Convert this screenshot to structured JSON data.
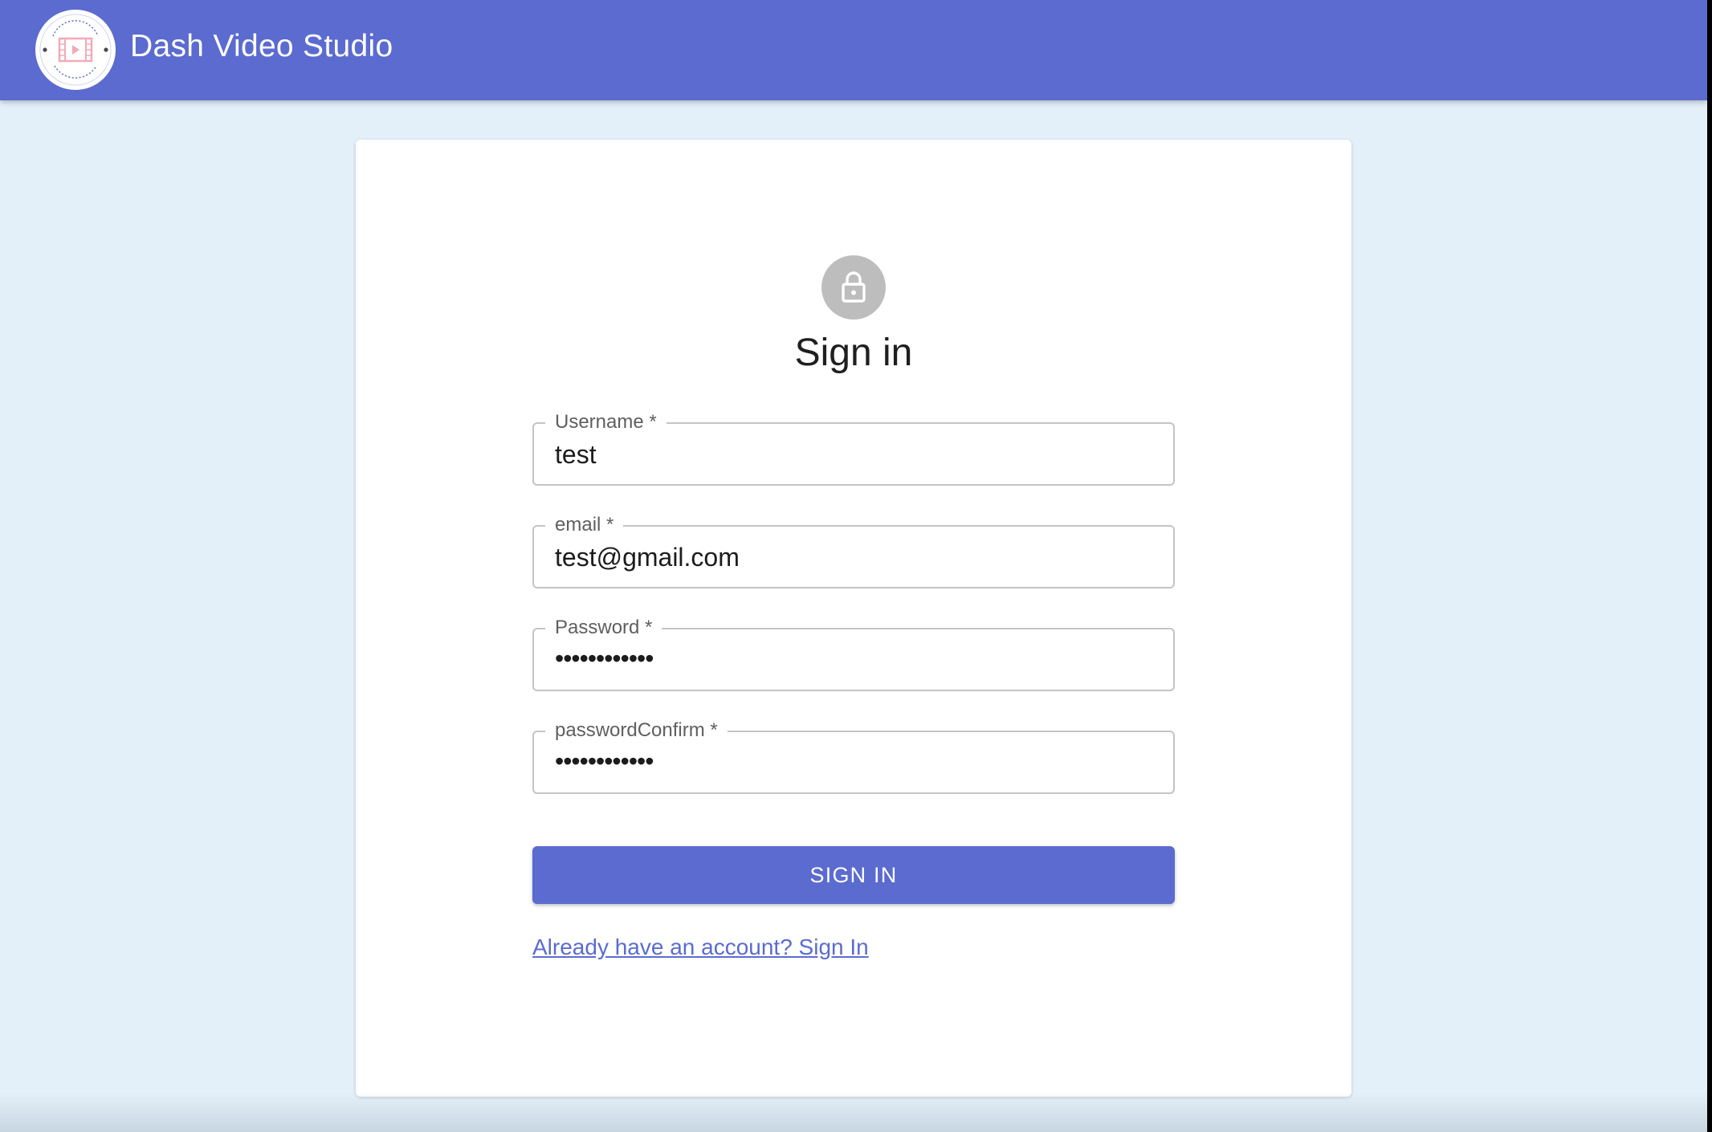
{
  "appbar": {
    "title": "Dash Video Studio",
    "logo_icon": "film-strip-play-icon",
    "logo_ring_top": "DASH Video Studio",
    "logo_ring_bottom": "Serve everywhere",
    "color": "#5b6bd0"
  },
  "form": {
    "heading": "Sign in",
    "avatar_icon": "lock-icon",
    "fields": [
      {
        "label": "Username *",
        "value": "test",
        "type": "text"
      },
      {
        "label": "email *",
        "value": "test@gmail.com",
        "type": "text"
      },
      {
        "label": "Password *",
        "value": "••••••••••••",
        "type": "password"
      },
      {
        "label": "passwordConfirm *",
        "value": "••••••••••••",
        "type": "password"
      }
    ],
    "submit_label": "SIGN IN",
    "alt_link": "Already have an account? Sign In"
  },
  "colors": {
    "primary": "#5b6bd0",
    "background": "#e4f0f9",
    "card": "#ffffff",
    "avatar": "#bdbdbd"
  }
}
